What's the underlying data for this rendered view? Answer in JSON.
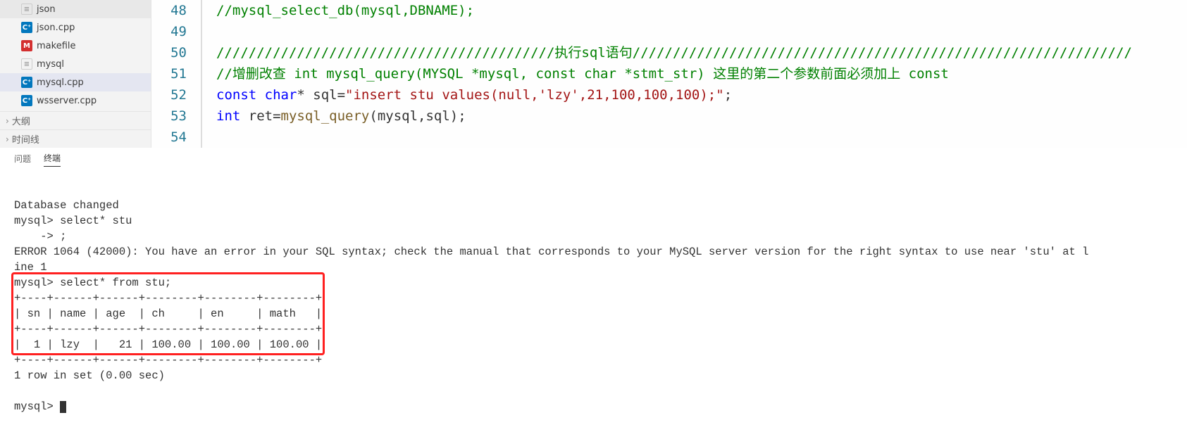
{
  "sidebar": {
    "files": [
      {
        "icon": "json",
        "name": "json"
      },
      {
        "icon": "cpp",
        "name": "json.cpp"
      },
      {
        "icon": "make",
        "name": "makefile"
      },
      {
        "icon": "mysql",
        "name": "mysql"
      },
      {
        "icon": "cpp",
        "name": "mysql.cpp",
        "selected": true
      },
      {
        "icon": "cpp",
        "name": "wsserver.cpp"
      }
    ],
    "outline_label": "大纲",
    "timeline_label": "时间线"
  },
  "editor": {
    "line_numbers": [
      "48",
      "49",
      "50",
      "51",
      "52",
      "53",
      "54"
    ],
    "code": {
      "l48": "//mysql_select_db(mysql,DBNAME);",
      "l50a": "//////////////////////////////////////////执行sql语句//////////////////////////////////////////////////////////////",
      "l51a": "//增删改查 ",
      "l51b": "int",
      "l51c": " mysql_query(MYSQL *mysql, ",
      "l51d": "const char",
      "l51e": " *stmt_str)",
      "l51f": " 这里的第二个参数前面必须加上 ",
      "l51g": "const",
      "l52a": "const",
      "l52b": " char",
      "l52c": "* sql=",
      "l52d": "\"insert stu values(null,'lzy',21,100,100,100);\"",
      "l52e": ";",
      "l53a": "int",
      "l53b": " ret=",
      "l53c": "mysql_query",
      "l53d": "(mysql,sql);"
    }
  },
  "panel": {
    "tab_problems": "问题",
    "tab_terminal": "终端"
  },
  "terminal": {
    "l1": "Database changed",
    "l2": "mysql> select* stu",
    "l3": "    -> ;",
    "l4": "ERROR 1064 (42000): You have an error in your SQL syntax; check the manual that corresponds to your MySQL server version for the right syntax to use near 'stu' at l",
    "l5": "ine 1",
    "l6": "mysql> select* from stu;",
    "l7": "+----+------+------+--------+--------+--------+",
    "l8": "| sn | name | age  | ch     | en     | math   |",
    "l9": "+----+------+------+--------+--------+--------+",
    "l10": "|  1 | lzy  |   21 | 100.00 | 100.00 | 100.00 |",
    "l11": "+----+------+------+--------+--------+--------+",
    "l12": "1 row in set (0.00 sec)",
    "l13": "",
    "l14": "mysql> "
  }
}
